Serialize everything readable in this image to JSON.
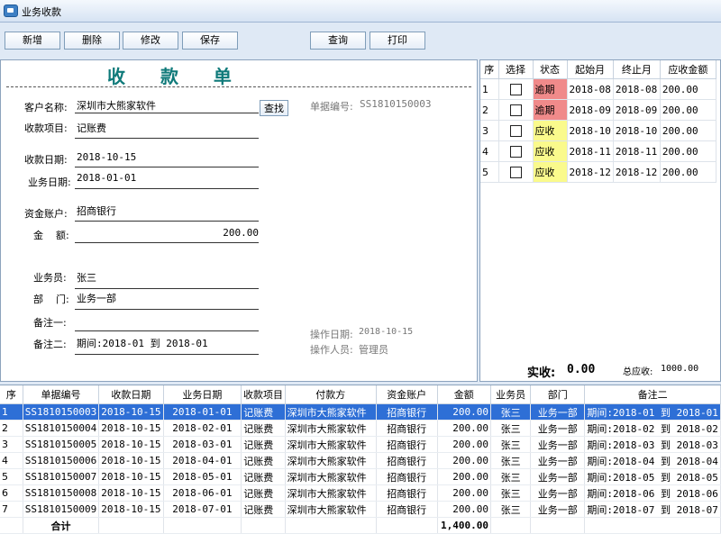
{
  "window": {
    "title": "业务收款"
  },
  "toolbar": {
    "add": "新增",
    "delete": "删除",
    "edit": "修改",
    "save": "保存",
    "query": "查询",
    "print": "打印"
  },
  "form": {
    "title": "收 款 单",
    "customer_label": "客户名称:",
    "customer": "深圳市大熊家软件",
    "find_label": "查找",
    "doc_no_label": "单据编号:",
    "doc_no": "SS1810150003",
    "item_label": "收款项目:",
    "item": "记账费",
    "receipt_date_label": "收款日期:",
    "receipt_date": "2018-10-15",
    "biz_date_label": "业务日期:",
    "biz_date": "2018-01-01",
    "account_label": "资金账户:",
    "account": "招商银行",
    "amount_label": "金    额:",
    "amount": "200.00",
    "salesman_label": "业务员:",
    "salesman": "张三",
    "dept_label": "部    门:",
    "dept": "业务一部",
    "note1_label": "备注一:",
    "note1": "",
    "note2_label": "备注二:",
    "note2": "期间:2018-01 到 2018-01",
    "op_date_label": "操作日期:",
    "op_date": "2018-10-15",
    "operator_label": "操作人员:",
    "operator": "管理员"
  },
  "periods": {
    "headers": [
      "序",
      "选择",
      "状态",
      "起始月",
      "终止月",
      "应收金额"
    ],
    "rows": [
      {
        "no": "1",
        "status": "逾期",
        "start": "2018-08",
        "end": "2018-08",
        "amount": "200.00"
      },
      {
        "no": "2",
        "status": "逾期",
        "start": "2018-09",
        "end": "2018-09",
        "amount": "200.00"
      },
      {
        "no": "3",
        "status": "应收",
        "start": "2018-10",
        "end": "2018-10",
        "amount": "200.00"
      },
      {
        "no": "4",
        "status": "应收",
        "start": "2018-11",
        "end": "2018-11",
        "amount": "200.00"
      },
      {
        "no": "5",
        "status": "应收",
        "start": "2018-12",
        "end": "2018-12",
        "amount": "200.00"
      }
    ],
    "received_label": "实收:",
    "received": "0.00",
    "total_label": "总应收:",
    "total": "1000.00"
  },
  "grid": {
    "headers": [
      "序",
      "单据编号",
      "收款日期",
      "业务日期",
      "收款项目",
      "付款方",
      "资金账户",
      "金额",
      "业务员",
      "部门",
      "备注二"
    ],
    "rows": [
      [
        "1",
        "SS1810150003",
        "2018-10-15",
        "2018-01-01",
        "记账费",
        "深圳市大熊家软件",
        "招商银行",
        "200.00",
        "张三",
        "业务一部",
        "期间:2018-01 到 2018-01"
      ],
      [
        "2",
        "SS1810150004",
        "2018-10-15",
        "2018-02-01",
        "记账费",
        "深圳市大熊家软件",
        "招商银行",
        "200.00",
        "张三",
        "业务一部",
        "期间:2018-02 到 2018-02"
      ],
      [
        "3",
        "SS1810150005",
        "2018-10-15",
        "2018-03-01",
        "记账费",
        "深圳市大熊家软件",
        "招商银行",
        "200.00",
        "张三",
        "业务一部",
        "期间:2018-03 到 2018-03"
      ],
      [
        "4",
        "SS1810150006",
        "2018-10-15",
        "2018-04-01",
        "记账费",
        "深圳市大熊家软件",
        "招商银行",
        "200.00",
        "张三",
        "业务一部",
        "期间:2018-04 到 2018-04"
      ],
      [
        "5",
        "SS1810150007",
        "2018-10-15",
        "2018-05-01",
        "记账费",
        "深圳市大熊家软件",
        "招商银行",
        "200.00",
        "张三",
        "业务一部",
        "期间:2018-05 到 2018-05"
      ],
      [
        "6",
        "SS1810150008",
        "2018-10-15",
        "2018-06-01",
        "记账费",
        "深圳市大熊家软件",
        "招商银行",
        "200.00",
        "张三",
        "业务一部",
        "期间:2018-06 到 2018-06"
      ],
      [
        "7",
        "SS1810150009",
        "2018-10-15",
        "2018-07-01",
        "记账费",
        "深圳市大熊家软件",
        "招商银行",
        "200.00",
        "张三",
        "业务一部",
        "期间:2018-07 到 2018-07"
      ]
    ],
    "total_label": "合计",
    "total_amount": "1,400.00"
  },
  "colors": {
    "overdue": "#f08a8a",
    "due": "#fafa8c",
    "selected_row": "#2e6fd6",
    "title": "#0f7a7a"
  },
  "icons": {
    "app": "window-app-icon"
  }
}
